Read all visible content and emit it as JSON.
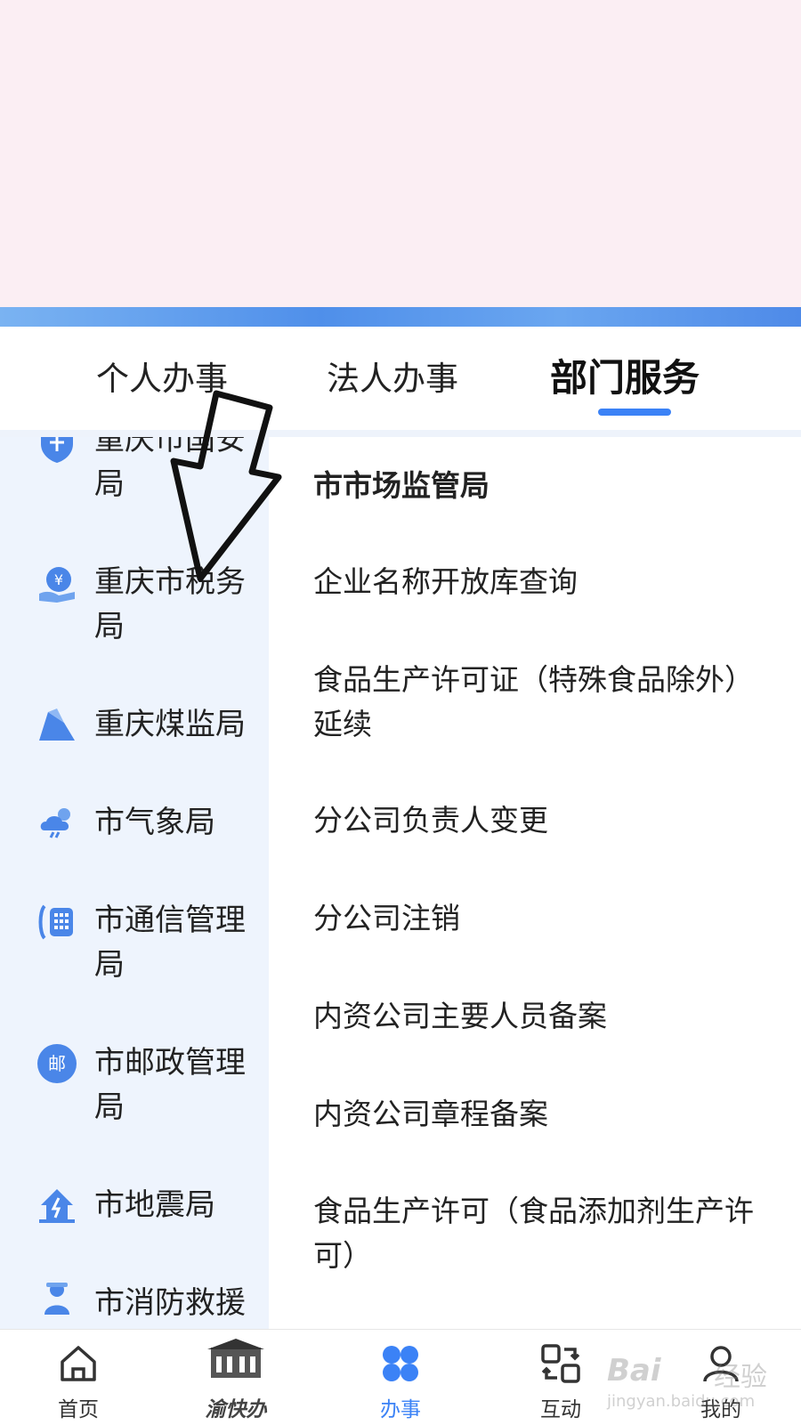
{
  "tabs": [
    {
      "label": "个人办事"
    },
    {
      "label": "法人办事"
    },
    {
      "label": "部门服务"
    }
  ],
  "sidebar": {
    "items": [
      {
        "label": "重庆市国安局",
        "icon": "shield-icon"
      },
      {
        "label": "重庆市税务局",
        "icon": "tax-icon"
      },
      {
        "label": "重庆煤监局",
        "icon": "coal-icon"
      },
      {
        "label": "市气象局",
        "icon": "weather-icon"
      },
      {
        "label": "市通信管理局",
        "icon": "phone-icon"
      },
      {
        "label": "市邮政管理局",
        "icon": "postal-icon"
      },
      {
        "label": "市地震局",
        "icon": "earthquake-icon"
      },
      {
        "label": "市消防救援",
        "icon": "firefighter-icon"
      }
    ],
    "postal_glyph": "邮"
  },
  "content": {
    "heading": "市市场监管局",
    "items": [
      "企业名称开放库查询",
      "食品生产许可证（特殊食品除外）延续",
      "分公司负责人变更",
      "分公司注销",
      "内资公司主要人员备案",
      "内资公司章程备案",
      "食品生产许可（食品添加剂生产许可）"
    ]
  },
  "tabbar": {
    "items": [
      {
        "label": "首页",
        "icon": "home-icon"
      },
      {
        "label": "渝快办",
        "icon": "logo-icon"
      },
      {
        "label": "办事",
        "icon": "services-icon"
      },
      {
        "label": "互动",
        "icon": "interact-icon"
      },
      {
        "label": "我的",
        "icon": "profile-icon"
      }
    ]
  },
  "watermark": {
    "line1": "Bai",
    "line2": "经验",
    "line3": "jingyan.baidu.com"
  },
  "colors": {
    "accent": "#3b82f6",
    "banner": "#fbeef3",
    "sidebar_bg": "#eef4fd",
    "strip": "#4f8fea"
  }
}
